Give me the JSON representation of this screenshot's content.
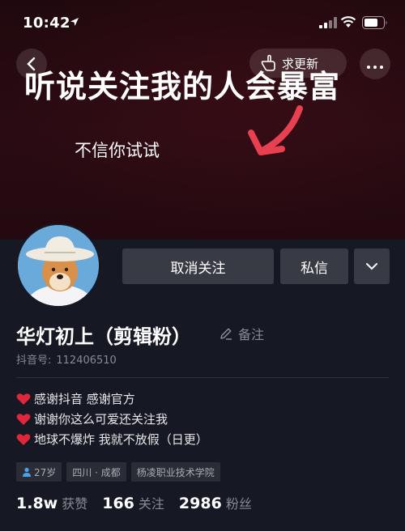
{
  "status_bar": {
    "time": "10:42"
  },
  "banner": {
    "update_label": "求更新",
    "headline": "听说关注我的人会暴富",
    "subline": "不信你试试"
  },
  "profile": {
    "buttons": {
      "unfollow": "取消关注",
      "message": "私信"
    },
    "nickname": "华灯初上（剪辑粉）",
    "remark": "备注",
    "douyin_id_label": "抖音号:",
    "douyin_id": "112406510",
    "bio": [
      "感谢抖音  感谢官方",
      "谢谢你这么可爱还关注我",
      "地球不爆炸  我就不放假（日更）"
    ],
    "tags": {
      "age": "27岁",
      "location": "四川 · 成都",
      "school": "杨凌职业技术学院"
    },
    "stats": [
      {
        "num": "1.8w",
        "label": "获赞"
      },
      {
        "num": "166",
        "label": "关注"
      },
      {
        "num": "2986",
        "label": "粉丝"
      }
    ]
  },
  "colors": {
    "background": "#161823",
    "button": "#393b44",
    "heart": "#e0263a",
    "arrow": "#e84050",
    "muted_text": "#8a8b91"
  },
  "icons": [
    "location-arrow-icon",
    "signal-icon",
    "wifi-icon",
    "battery-icon",
    "back-icon",
    "hand-pointer-icon",
    "more-icon",
    "chevron-down-icon",
    "edit-icon",
    "heart-icon",
    "person-icon"
  ]
}
